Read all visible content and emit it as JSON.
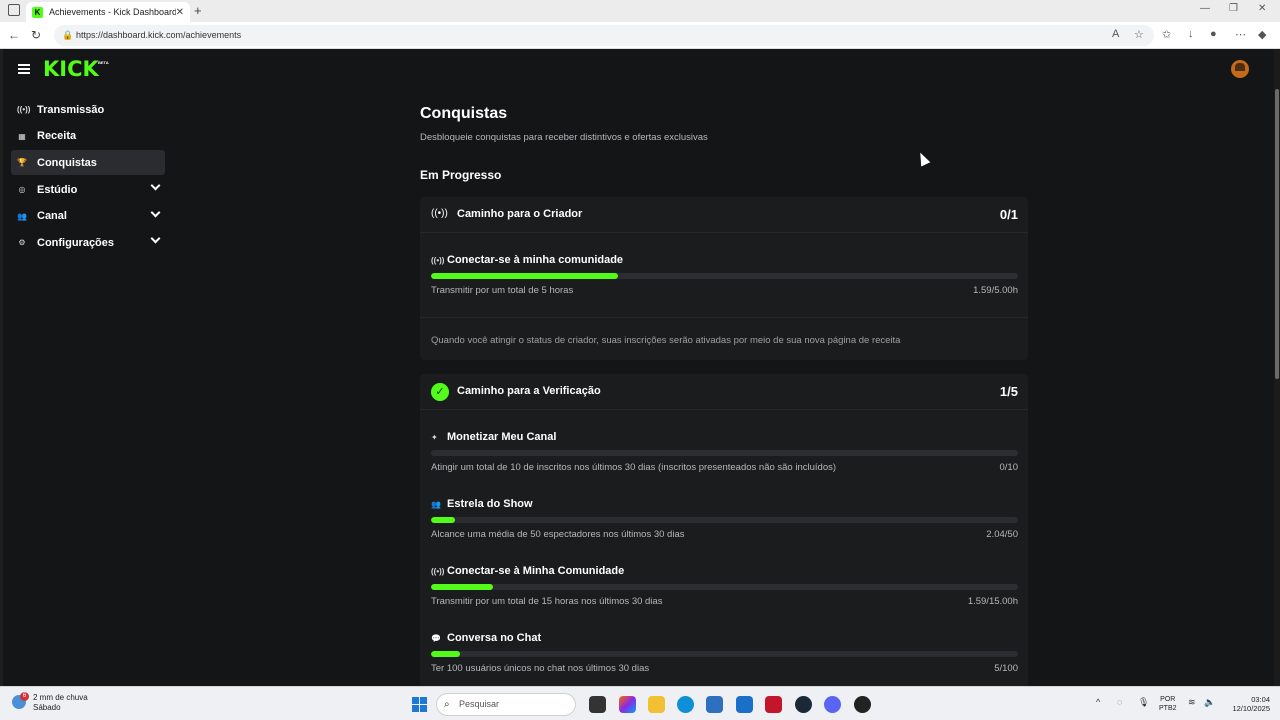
{
  "browser": {
    "tab_title": "Achievements - Kick Dashboard",
    "url": "https://dashboard.kick.com/achievements"
  },
  "app": {
    "logo": "KICK",
    "logo_badge": "BETA",
    "accent_color": "#53fc18"
  },
  "sidebar": {
    "items": [
      {
        "label": "Transmissão",
        "icon": "broadcast-icon",
        "active": false,
        "expandable": false
      },
      {
        "label": "Receita",
        "icon": "chart-icon",
        "active": false,
        "expandable": false
      },
      {
        "label": "Conquistas",
        "icon": "trophy-icon",
        "active": true,
        "expandable": false
      },
      {
        "label": "Estúdio",
        "icon": "studio-icon",
        "active": false,
        "expandable": true
      },
      {
        "label": "Canal",
        "icon": "users-icon",
        "active": false,
        "expandable": true
      },
      {
        "label": "Configurações",
        "icon": "gear-icon",
        "active": false,
        "expandable": true
      }
    ]
  },
  "main": {
    "title": "Conquistas",
    "subtitle": "Desbloqueie conquistas para receber distintivos e ofertas exclusivas",
    "section_title": "Em Progresso",
    "cards": [
      {
        "title": "Caminho para o Criador",
        "count": "0/1",
        "icon": "broadcast-icon",
        "achievements": [
          {
            "title": "Conectar-se à minha comunidade",
            "icon": "broadcast-icon",
            "description": "Transmitir por um total de 5 horas",
            "value": "1.59/5.00h",
            "progress": 0.318
          }
        ],
        "note": "Quando você atingir o status de criador, suas inscrições serão ativadas por meio de sua nova página de receita"
      },
      {
        "title": "Caminho para a Verificação",
        "count": "1/5",
        "icon": "verified-check-icon",
        "achievements": [
          {
            "title": "Monetizar Meu Canal",
            "icon": "sparkle-icon",
            "description": "Atingir um total de 10 de inscritos nos últimos 30 dias (inscritos presenteados não são incluídos)",
            "value": "0/10",
            "progress": 0.0
          },
          {
            "title": "Estrela do Show",
            "icon": "users-icon",
            "description": "Alcance uma média de 50 espectadores nos últimos 30 dias",
            "value": "2.04/50",
            "progress": 0.041
          },
          {
            "title": "Conectar-se à Minha Comunidade",
            "icon": "broadcast-icon",
            "description": "Transmitir por um total de 15 horas nos últimos 30 dias",
            "value": "1.59/15.00h",
            "progress": 0.106
          },
          {
            "title": "Conversa no Chat",
            "icon": "chat-icon",
            "description": "Ter 100 usuários únicos no chat nos últimos 30 dias",
            "value": "5/100",
            "progress": 0.05
          }
        ]
      }
    ]
  },
  "taskbar": {
    "weather_text": "2 mm de chuva",
    "weather_day": "Sábado",
    "weather_badge": "6",
    "search_placeholder": "Pesquisar",
    "lang_1": "POR",
    "lang_2": "PTB2",
    "time": "03:04",
    "date": "12/10/2025"
  }
}
